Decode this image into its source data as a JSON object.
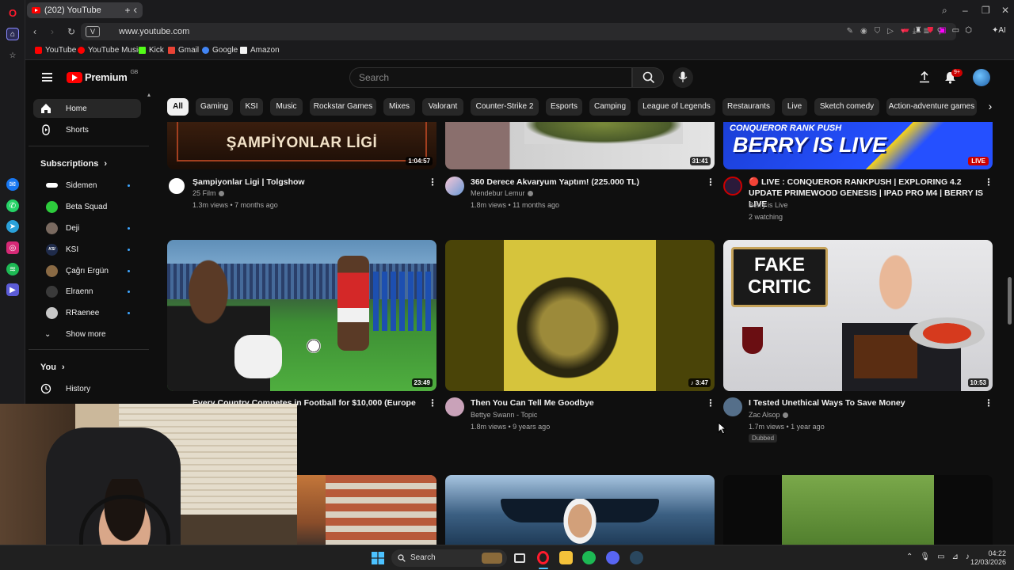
{
  "browser": {
    "tab_title": "(202) YouTube",
    "new_tab": "+",
    "url": "www.youtube.com",
    "url_chip": "V",
    "ai_label": "AI",
    "bookmarks": [
      {
        "label": "YouTube",
        "color": "#ff0000"
      },
      {
        "label": "YouTube Music",
        "color": "#ff0000"
      },
      {
        "label": "Kick",
        "color": "#53fc18"
      },
      {
        "label": "Gmail",
        "color": "#ea4335"
      },
      {
        "label": "Google",
        "color": "#4285f4"
      },
      {
        "label": "Amazon",
        "color": "#f2f2f2"
      }
    ]
  },
  "youtube": {
    "logo_text": "Premium",
    "logo_superscript": "GB",
    "search_placeholder": "Search",
    "notification_count": "9+",
    "sidebar": {
      "primary": [
        {
          "label": "Home",
          "icon": "home-icon"
        },
        {
          "label": "Shorts",
          "icon": "shorts-icon"
        }
      ],
      "subscriptions_title": "Subscriptions",
      "subscriptions": [
        {
          "label": "Sidemen",
          "color": "#ffffff"
        },
        {
          "label": "Beta Squad",
          "color": "#2dcc3c"
        },
        {
          "label": "Deji",
          "color": "#7a6a60"
        },
        {
          "label": "KSI",
          "color": "#1f2b4a"
        },
        {
          "label": "Çağrı Ergün",
          "color": "#8a6a44"
        },
        {
          "label": "Elraenn",
          "color": "#3a3a3a"
        },
        {
          "label": "RRaenee",
          "color": "#c8c8c8"
        }
      ],
      "show_more": "Show more",
      "you_title": "You",
      "history": "History"
    },
    "chips": [
      "All",
      "Gaming",
      "KSI",
      "Music",
      "Rockstar Games",
      "Mixes",
      "Valorant",
      "Counter-Strike 2",
      "Esports",
      "Camping",
      "League of Legends",
      "Restaurants",
      "Live",
      "Sketch comedy",
      "Action-adventure games"
    ],
    "videos": [
      {
        "title": "Şampiyonlar Ligi | Tolgshow",
        "channel": "25 Film",
        "meta": "1.3m views • 7 months ago",
        "duration": "1:04:57",
        "thumb_text": "ŞAMPİYONLAR LİGİ"
      },
      {
        "title": "360 Derece Akvaryum Yaptım! (225.000 TL)",
        "channel": "Mendebur Lemur",
        "meta": "1.8m views • 11 months ago",
        "duration": "31:41"
      },
      {
        "title": "🔴 LIVE : CONQUEROR RANKPUSH | EXPLORING 4.2 UPDATE PRIMEWOOD GENESIS | IPAD PRO M4 | BERRY IS LIVE",
        "channel": "Berry is Live",
        "meta": "2 watching",
        "badge": "LIVE",
        "thumb_text_top": "CONQUEROR RANK PUSH",
        "thumb_text": "BERRY IS LIVE"
      },
      {
        "title": "Every Country Competes in Football for $10,000 (Europe",
        "duration": "23:49"
      },
      {
        "title": "Then You Can Tell Me Goodbye",
        "channel": "Bettye Swann - Topic",
        "meta": "1.8m views • 9 years ago",
        "duration": "♪ 3:47"
      },
      {
        "title": "I Tested Unethical Ways To Save Money",
        "channel": "Zac Alsop",
        "meta": "1.7m views • 1 year ago",
        "duration": "10:53",
        "badge": "Dubbed",
        "thumb_text": "FAKE CRITIC"
      }
    ]
  },
  "taskbar": {
    "search_label": "Search",
    "time": "04:22",
    "date": "12/03/2026"
  }
}
